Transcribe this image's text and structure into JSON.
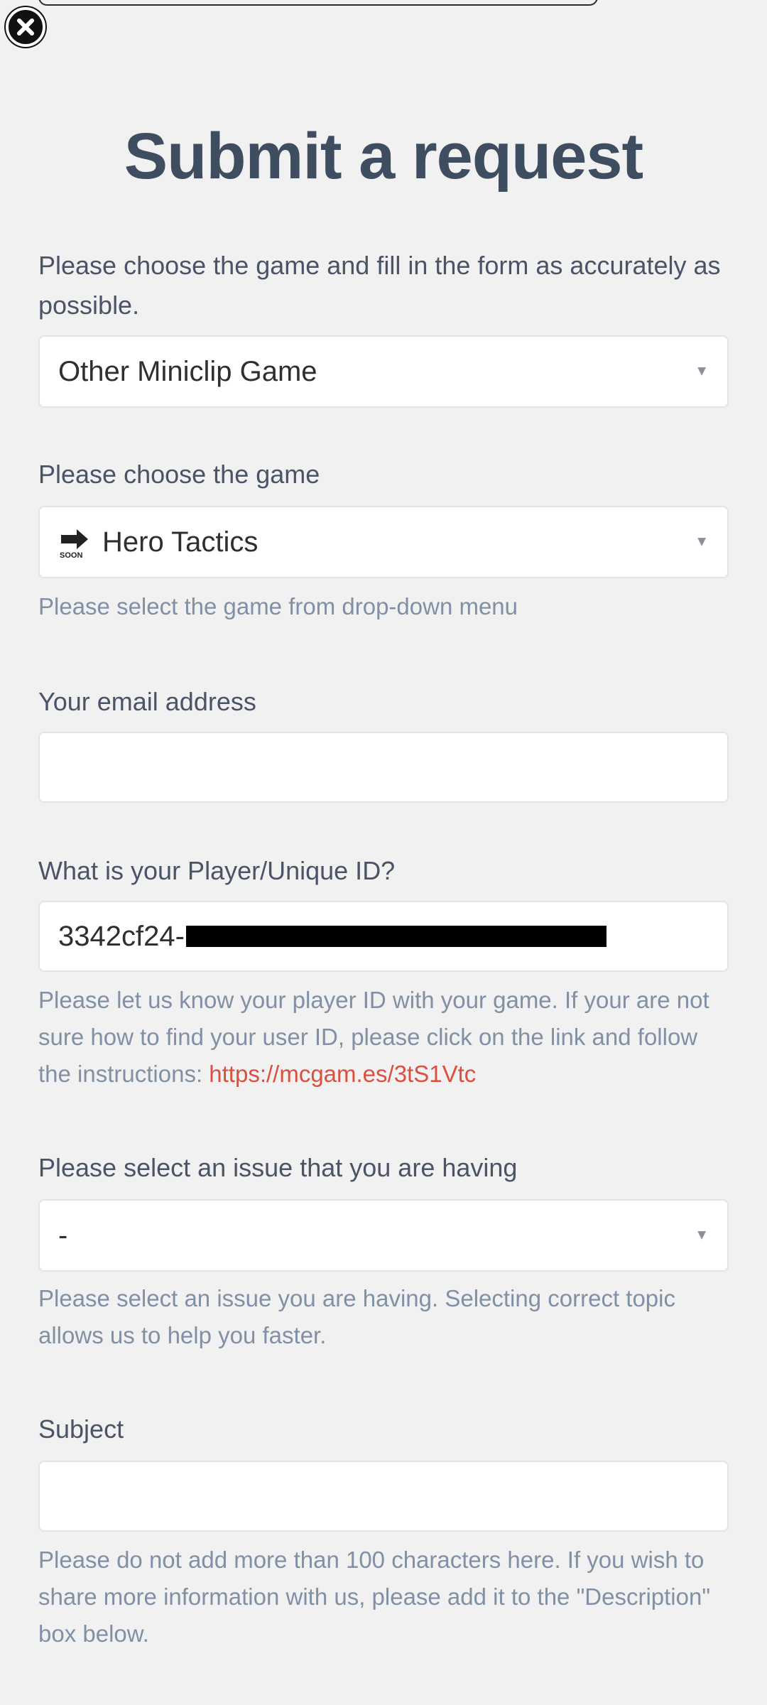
{
  "page": {
    "title": "Submit a request",
    "intro": "Please choose the game and fill in the form as accurately as possible."
  },
  "form": {
    "category_select": {
      "value": "Other Miniclip Game"
    },
    "game": {
      "label": "Please choose the game",
      "value": "Hero Tactics",
      "icon": "arrow-soon-icon",
      "hint": "Please select the game from drop-down menu"
    },
    "email": {
      "label": "Your email address",
      "value": ""
    },
    "player_id": {
      "label": "What is your Player/Unique ID?",
      "value_prefix": "3342cf24-",
      "hint_text": "Please let us know your player ID with your game. If your are not sure how to find your user ID, please click on the link and follow the instructions: ",
      "hint_link": "https://mcgam.es/3tS1Vtc"
    },
    "issue": {
      "label": "Please select an issue that you are having",
      "value": "-",
      "hint": "Please select an issue you are having. Selecting correct topic allows us to help you faster."
    },
    "subject": {
      "label": "Subject",
      "value": "",
      "hint": "Please do not add more than 100 characters here. If you wish to share more information with us, please add it to the \"Description\" box below."
    }
  },
  "icons": {
    "close": "close-icon",
    "dropdown": "chevron-down-icon"
  },
  "colors": {
    "link": "#d9503f",
    "title": "#3f4d60",
    "hint": "#8190a5",
    "background": "#f1f1f2"
  }
}
